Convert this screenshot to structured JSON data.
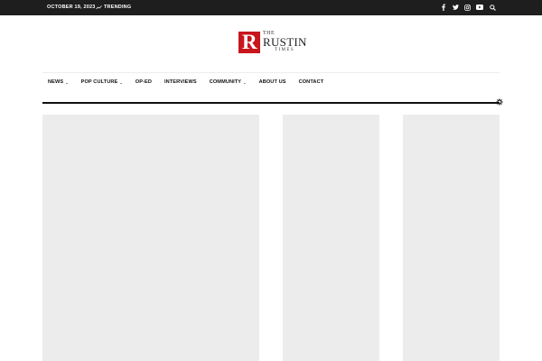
{
  "topbar": {
    "date": "OCTOBER 19, 2023",
    "trending_label": "TRENDING",
    "social_icons": [
      "facebook-icon",
      "twitter-icon",
      "instagram-icon",
      "youtube-icon",
      "search-icon"
    ],
    "background": "#1e1e1e"
  },
  "logo": {
    "mark_letter": "R",
    "line1": "THE",
    "line2": "RUSTIN",
    "line3": "TIMES",
    "brand_color": "#c8161d"
  },
  "nav": {
    "items": [
      {
        "label": "NEWS",
        "has_dropdown": true
      },
      {
        "label": "POP CULTURE",
        "has_dropdown": true
      },
      {
        "label": "OP-ED",
        "has_dropdown": false
      },
      {
        "label": "INTERVIEWS",
        "has_dropdown": false
      },
      {
        "label": "COMMUNITY",
        "has_dropdown": true
      },
      {
        "label": "ABOUT US",
        "has_dropdown": false
      },
      {
        "label": "CONTACT",
        "has_dropdown": false
      }
    ],
    "chevron": "⌄"
  },
  "content": {
    "placeholder_color": "#ececec"
  }
}
